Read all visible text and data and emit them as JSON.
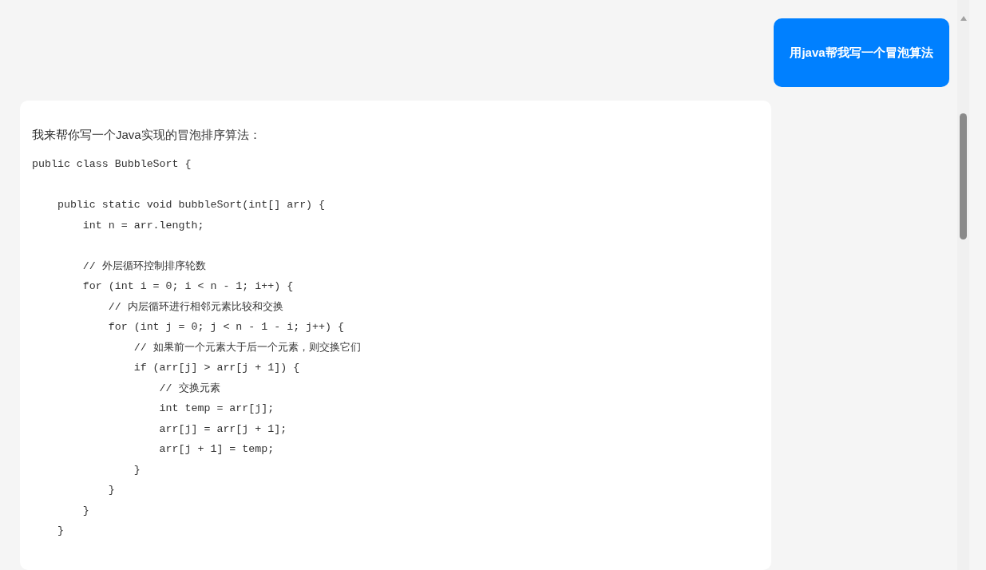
{
  "messages": [
    {
      "kind": "user",
      "text": "用java帮我写一个冒泡算法"
    },
    {
      "kind": "assistant",
      "text": "我来帮你写一个Java实现的冒泡排序算法：",
      "code": "public class BubbleSort {\n\n    public static void bubbleSort(int[] arr) {\n        int n = arr.length;\n\n        // 外层循环控制排序轮数\n        for (int i = 0; i < n - 1; i++) {\n            // 内层循环进行相邻元素比较和交换\n            for (int j = 0; j < n - 1 - i; j++) {\n                // 如果前一个元素大于后一个元素，则交换它们\n                if (arr[j] > arr[j + 1]) {\n                    // 交换元素\n                    int temp = arr[j];\n                    arr[j] = arr[j + 1];\n                    arr[j + 1] = temp;\n                }\n            }\n        }\n    }"
    }
  ]
}
